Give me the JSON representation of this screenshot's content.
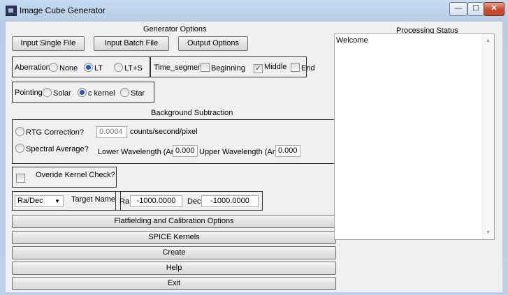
{
  "window": {
    "title": "Image Cube Generator",
    "minimize": "—",
    "maximize": "☐",
    "close": "✕"
  },
  "generator": {
    "heading": "Generator Options",
    "input_single": "Input Single File",
    "input_batch": "Input Batch File",
    "output_options": "Output Options"
  },
  "aberration": {
    "label": "Aberration",
    "options": [
      "None",
      "LT",
      "LT+S"
    ],
    "selected": "LT"
  },
  "time_segment": {
    "label": "Time_segment",
    "options": [
      "Beginning",
      "Middle",
      "End"
    ],
    "checked": "Middle"
  },
  "pointing": {
    "label": "Pointing",
    "options": [
      "Solar",
      "c kernel",
      "Star"
    ],
    "selected": "c kernel"
  },
  "background": {
    "heading": "Background Subtraction",
    "rtg_label": "RTG Correction?",
    "rtg_value": "0.0004",
    "rtg_units": "counts/second/pixel",
    "spectral_label": "Spectral Average?",
    "lower_label": "Lower Wavelength (Ang)",
    "lower_value": "0.000",
    "upper_label": "Upper Wavelength (Ang)",
    "upper_value": "0.000"
  },
  "override": {
    "label": "Overide Kernel Check?"
  },
  "target": {
    "coord_select": "Ra/Dec",
    "target_name_label": "Target Name",
    "ra_label": "Ra",
    "ra_value": "-1000.0000",
    "dec_label": "Dec",
    "dec_value": "-1000.0000"
  },
  "buttons": {
    "flatfielding": "Flatfielding and Calibration Options",
    "spice": "SPICE Kernels",
    "create": "Create",
    "help": "Help",
    "exit": "Exit"
  },
  "status": {
    "heading": "Processing Status",
    "text": "Welcome",
    "scroll_up": "▲",
    "scroll_down": "▼"
  },
  "colors": {
    "titlebar": "#c7dcf1",
    "client": "#f0f0f0",
    "radio_selected": "#1e5bb8",
    "close_button": "#c8482c"
  }
}
